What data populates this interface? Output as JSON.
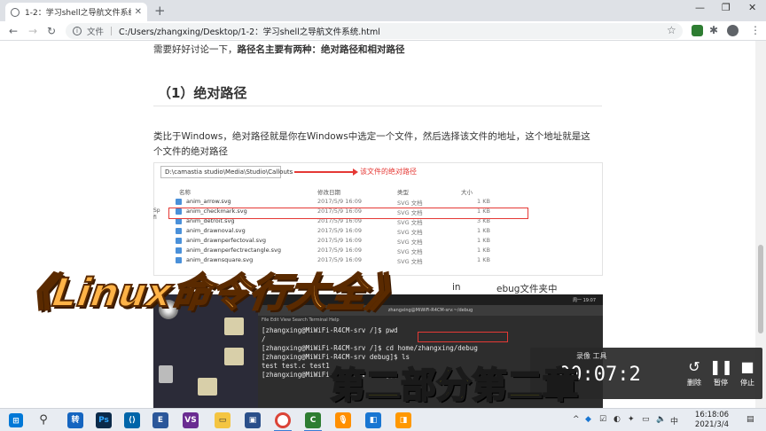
{
  "browser": {
    "tab_title": "1-2：学习shell之导航文件系统",
    "scheme_label": "文件",
    "url": "C:/Users/zhangxing/Desktop/1-2：学习shell之导航文件系统.html"
  },
  "article": {
    "intro_text": "需要好好讨论一下，",
    "intro_bold": "路径名主要有两种：绝对路径和相对路径",
    "heading": "（1）绝对路径",
    "para_line1": "类比于Windows，绝对路径就是你在Windows中选定一个文件，然后选择该文件的地址，这个地址就是这",
    "para_line2": "个文件的绝对路径",
    "frag_right1": "in",
    "frag_right2": "ebug文件夹中"
  },
  "explorer": {
    "address": "D:\\camastia studio\\Media\\Studio\\Callouts",
    "annotation": "该文件的绝对路径",
    "columns": {
      "name": "名称",
      "date": "修改日期",
      "type": "类型",
      "size": "大小"
    },
    "rows": [
      {
        "name": "anim_arrow.svg",
        "date": "2017/5/9 16:09",
        "type": "SVG 文档",
        "size": "1 KB"
      },
      {
        "name": "anim_checkmark.svg",
        "date": "2017/5/9 16:09",
        "type": "SVG 文档",
        "size": "1 KB"
      },
      {
        "name": "anim_detroit.svg",
        "date": "2017/5/9 16:09",
        "type": "SVG 文档",
        "size": "3 KB"
      },
      {
        "name": "anim_drawnoval.svg",
        "date": "2017/5/9 16:09",
        "type": "SVG 文档",
        "size": "1 KB"
      },
      {
        "name": "anim_drawnperfectoval.svg",
        "date": "2017/5/9 16:09",
        "type": "SVG 文档",
        "size": "1 KB"
      },
      {
        "name": "anim_drawnperfectrectangle.svg",
        "date": "2017/5/9 16:09",
        "type": "SVG 文档",
        "size": "1 KB"
      },
      {
        "name": "anim_drawnsquare.svg",
        "date": "2017/5/9 16:09",
        "type": "SVG 文档",
        "size": "1 KB"
      }
    ],
    "side_labels": [
      "Sp",
      "fi"
    ]
  },
  "terminal": {
    "title": "zhangxing@MiWiFi-R4CM-srv:~/debug",
    "menu": "File  Edit  View  Search  Terminal  Help",
    "lines": [
      "[zhangxing@MiWiFi-R4CM-srv /]$ pwd",
      "/",
      "[zhangxing@MiWiFi-R4CM-srv /]$ cd home/zhangxing/debug",
      "[zhangxing@MiWiFi-R4CM-srv debug]$ ls",
      "test   test.c   test1",
      "[zhangxing@MiWiFi-R4CM-srv debug]$"
    ],
    "topbar_time": "周一 19:07"
  },
  "overlay": {
    "title": "《Linux命令行大全》",
    "subtitle": "第二部分第二章"
  },
  "recorder": {
    "time": "00:07:2",
    "delete_label": "删除",
    "pause_label": "暂停",
    "stop_label": "停止",
    "top_text": "录像   工具"
  },
  "taskbar": {
    "clock_time": "16:18:06",
    "clock_date": "2021/3/4",
    "tray_lang": "中"
  }
}
